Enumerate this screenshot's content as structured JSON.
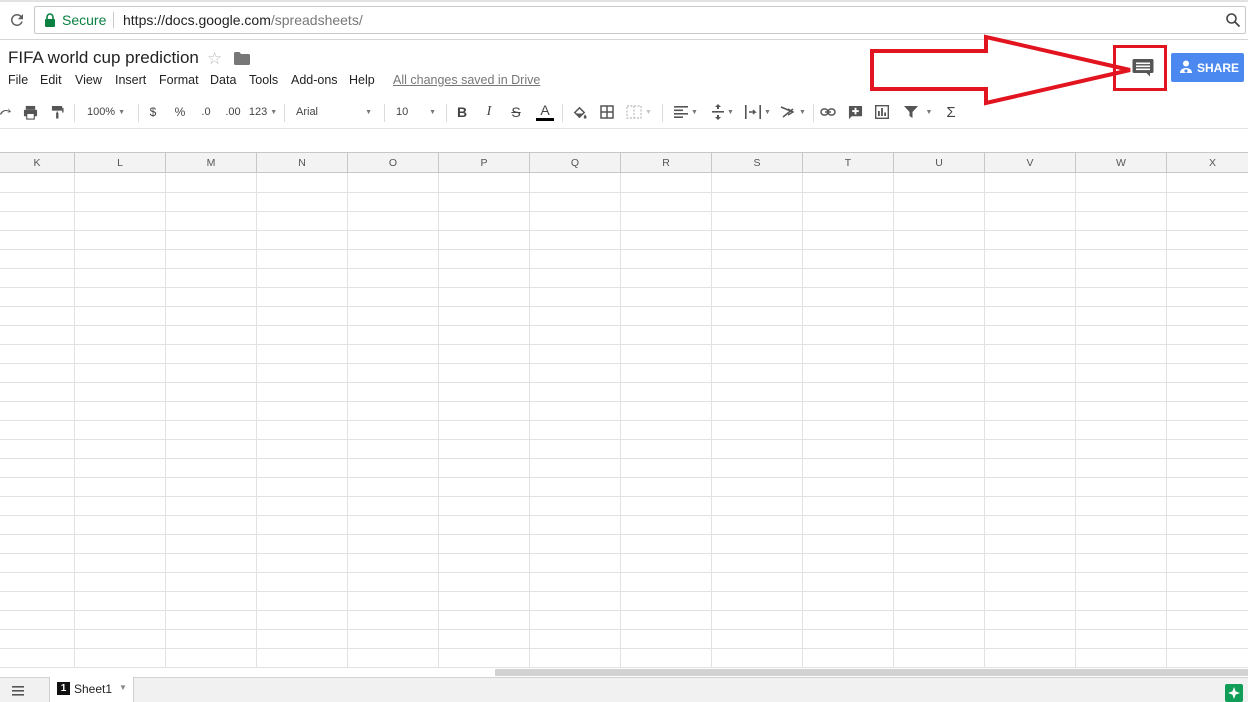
{
  "browser": {
    "secure_label": "Secure",
    "url_host": "https://docs.google.com",
    "url_path": "/spreadsheets/"
  },
  "doc": {
    "title": "FIFA world cup prediction",
    "saved_status": "All changes saved in Drive"
  },
  "menu": [
    "File",
    "Edit",
    "View",
    "Insert",
    "Format",
    "Data",
    "Tools",
    "Add-ons",
    "Help"
  ],
  "share": {
    "label": "SHARE",
    "color": "#4b89f0"
  },
  "annotation": {
    "color": "#e2141f",
    "target": "comments-button"
  },
  "toolbar": {
    "zoom": "100%",
    "currency": "$",
    "percent": "%",
    "decrease_decimals": ".0",
    "increase_decimals": ".00",
    "more_formats": "123",
    "font": "Arial",
    "font_size": "10",
    "bold": "B",
    "italic": "I",
    "strikethrough": "S",
    "text_color": "A",
    "sum": "Σ"
  },
  "columns": [
    "K",
    "L",
    "M",
    "N",
    "O",
    "P",
    "Q",
    "R",
    "S",
    "T",
    "U",
    "V",
    "W",
    "X"
  ],
  "sheet": {
    "number": "1",
    "name": "Sheet1"
  }
}
